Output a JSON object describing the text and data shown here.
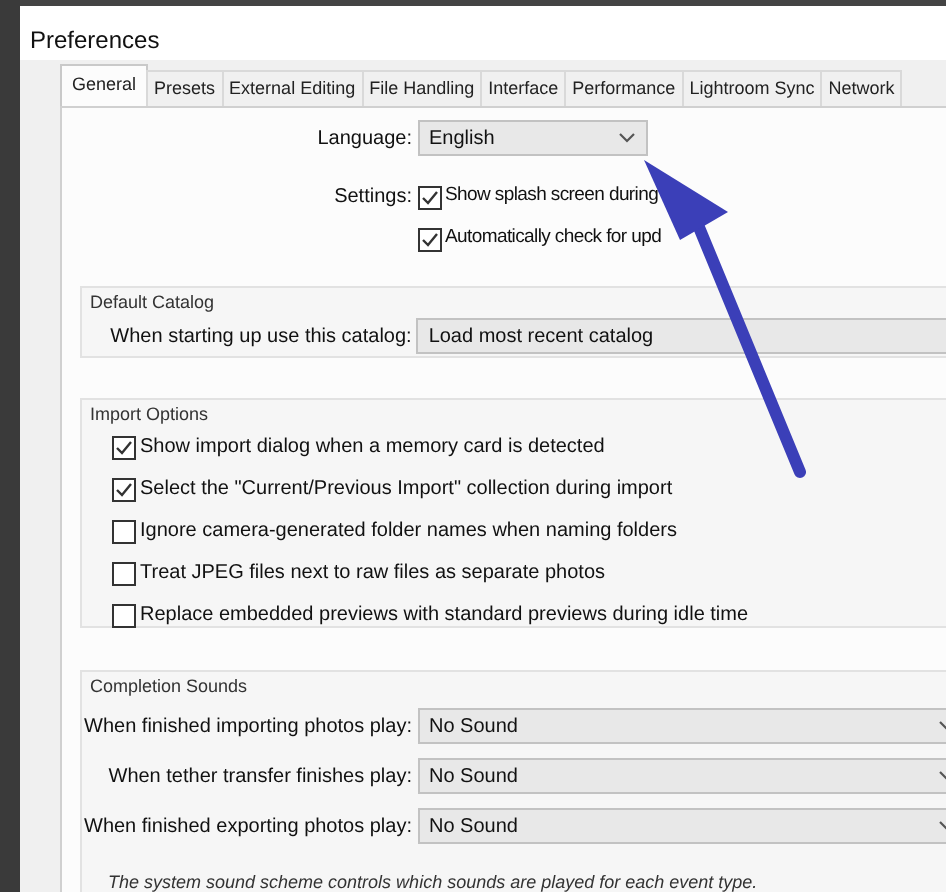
{
  "window": {
    "title": "Preferences"
  },
  "tabs": [
    {
      "label": "General",
      "selected": true
    },
    {
      "label": "Presets",
      "selected": false
    },
    {
      "label": "External Editing",
      "selected": false
    },
    {
      "label": "File Handling",
      "selected": false
    },
    {
      "label": "Interface",
      "selected": false
    },
    {
      "label": "Performance",
      "selected": false
    },
    {
      "label": "Lightroom Sync",
      "selected": false
    },
    {
      "label": "Network",
      "selected": false
    }
  ],
  "language": {
    "label": "Language:",
    "value": "English"
  },
  "settings": {
    "label": "Settings:",
    "options": [
      {
        "label": "Show splash screen during",
        "checked": true
      },
      {
        "label": "Automatically check for upd",
        "checked": true
      }
    ]
  },
  "default_catalog": {
    "title": "Default Catalog",
    "label": "When starting up use this catalog:",
    "value": "Load most recent catalog"
  },
  "import_options": {
    "title": "Import Options",
    "options": [
      {
        "label": "Show import dialog when a memory card is detected",
        "checked": true
      },
      {
        "label": "Select the \"Current/Previous Import\" collection during import",
        "checked": true
      },
      {
        "label": "Ignore camera-generated folder names when naming folders",
        "checked": false
      },
      {
        "label": "Treat JPEG files next to raw files as separate photos",
        "checked": false
      },
      {
        "label": "Replace embedded previews with standard previews during idle time",
        "checked": false
      }
    ]
  },
  "completion_sounds": {
    "title": "Completion Sounds",
    "rows": [
      {
        "label": "When finished importing photos play:",
        "value": "No Sound"
      },
      {
        "label": "When tether transfer finishes play:",
        "value": "No Sound"
      },
      {
        "label": "When finished exporting photos play:",
        "value": "No Sound"
      }
    ],
    "note": "The system sound scheme controls which sounds are played for each event type."
  }
}
